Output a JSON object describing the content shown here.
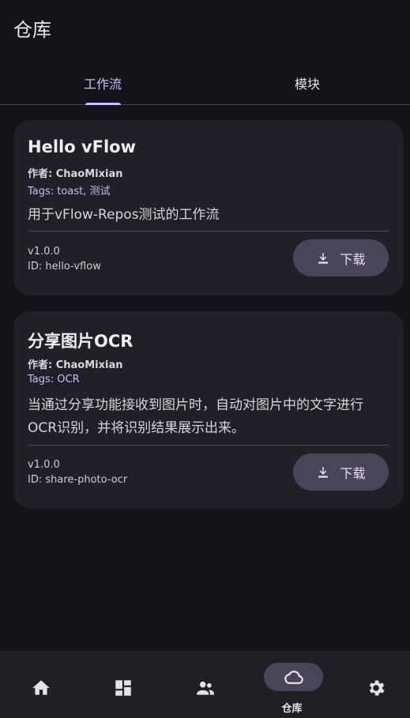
{
  "header": {
    "title": "仓库"
  },
  "tabs": [
    {
      "label": "工作流",
      "selected": true
    },
    {
      "label": "模块",
      "selected": false
    }
  ],
  "author_label": "作者: ",
  "tags_label": "Tags: ",
  "download_label": "下载",
  "cards": [
    {
      "title": "Hello vFlow",
      "author": "ChaoMixian",
      "tags": "toast, 测试",
      "description": "用于vFlow-Repos测试的工作流",
      "version": "v1.0.0",
      "id": "ID: hello-vflow"
    },
    {
      "title": "分享图片OCR",
      "author": "ChaoMixian",
      "tags": "OCR",
      "description": "当通过分享功能接收到图片时，自动对图片中的文字进行OCR识别，并将识别结果展示出来。",
      "version": "v1.0.0",
      "id": "ID: share-photo-ocr"
    }
  ],
  "bottom_nav": {
    "items": [
      {
        "icon": "home-icon"
      },
      {
        "icon": "dashboard-icon"
      },
      {
        "icon": "people-icon"
      },
      {
        "icon": "cloud-icon",
        "label": "仓库",
        "selected": true
      },
      {
        "icon": "settings-icon"
      }
    ]
  },
  "colors": {
    "background": "#15131a",
    "accent": "#cfbcff",
    "card": "#211f27",
    "button": "#4a4458"
  }
}
